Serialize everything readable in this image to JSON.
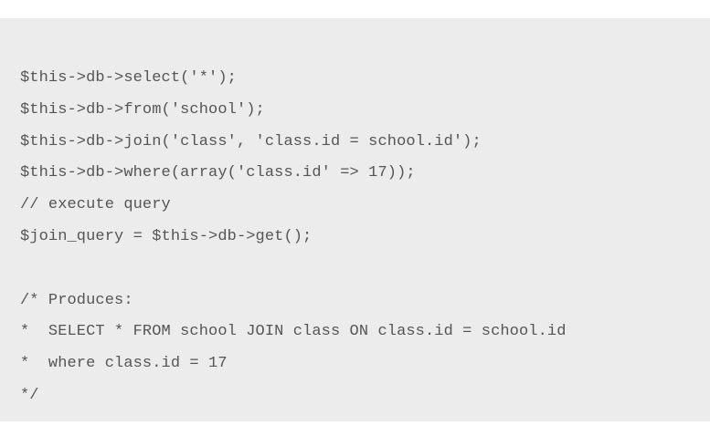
{
  "code": {
    "lines": [
      "$this->db->select('*');",
      "$this->db->from('school');",
      "$this->db->join('class', 'class.id = school.id');",
      "$this->db->where(array('class.id' => 17));",
      "// execute query",
      "$join_query = $this->db->get();",
      "",
      "/* Produces:",
      "*  SELECT * FROM school JOIN class ON class.id = school.id",
      "*  where class.id = 17",
      "*/"
    ]
  }
}
